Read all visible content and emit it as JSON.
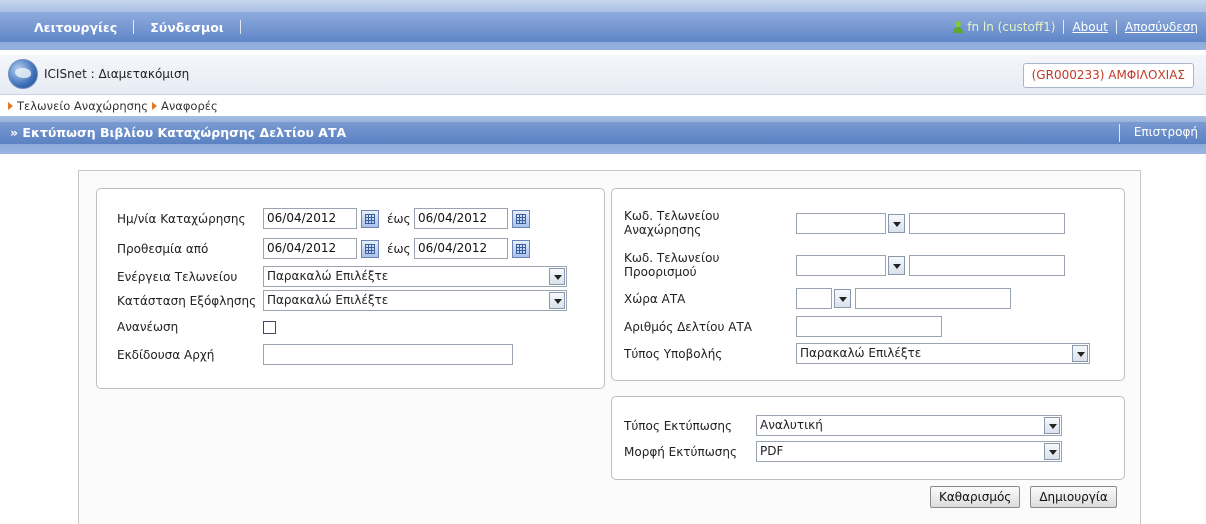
{
  "nav": {
    "items": [
      {
        "label": "Λειτουργίες"
      },
      {
        "label": "Σύνδεσμοι"
      }
    ],
    "user": "fn ln (custoff1)",
    "about": "About",
    "logout": "Αποσύνδεση"
  },
  "app": {
    "title": "ICISnet : Διαμετακόμιση",
    "office": "(GR000233) ΑΜΦΙΛΟΧΙΑΣ"
  },
  "breadcrumb": [
    "Τελωνείο Αναχώρησης",
    "Αναφορές"
  ],
  "page": {
    "title": "» Εκτύπωση Βιβλίου Καταχώρησης Δελτίου ΑΤΑ",
    "back": "Επιστροφή"
  },
  "left_panel": {
    "reg_date_label": "Ημ/νία Καταχώρησης",
    "reg_date_from": "06/04/2012",
    "reg_date_to_label": "έως",
    "reg_date_to": "06/04/2012",
    "deadline_label": "Προθεσμία από",
    "deadline_from": "06/04/2012",
    "deadline_to_label": "έως",
    "deadline_to": "06/04/2012",
    "office_action_label": "Ενέργεια Τελωνείου",
    "office_action_value": "Παρακαλώ Επιλέξτε",
    "settlement_label": "Κατάσταση Εξόφλησης",
    "settlement_value": "Παρακαλώ Επιλέξτε",
    "renewal_label": "Ανανέωση",
    "issuer_label": "Εκδίδουσα Αρχή",
    "issuer_value": ""
  },
  "right_panel": {
    "departure_label_1": "Κωδ. Τελωνείου",
    "departure_label_2": "Αναχώρησης",
    "destination_label_1": "Κωδ. Τελωνείου",
    "destination_label_2": "Προορισμού",
    "country_label": "Χώρα ΑΤΑ",
    "ata_number_label": "Αριθμός Δελτίου ΑΤΑ",
    "submission_type_label": "Τύπος Υποβολής",
    "submission_type_value": "Παρακαλώ Επιλέξτε"
  },
  "print_panel": {
    "print_type_label": "Τύπος Εκτύπωσης",
    "print_type_value": "Αναλυτική",
    "print_format_label": "Μορφή Εκτύπωσης",
    "print_format_value": "PDF"
  },
  "actions": {
    "clear": "Καθαρισμός",
    "create": "Δημιουργία"
  },
  "colors": {
    "nav_blue": "#5f86c8",
    "office_text": "#c23a2a",
    "crumb_arrow": "#e4772a",
    "user_link": "#e9f3c5"
  }
}
